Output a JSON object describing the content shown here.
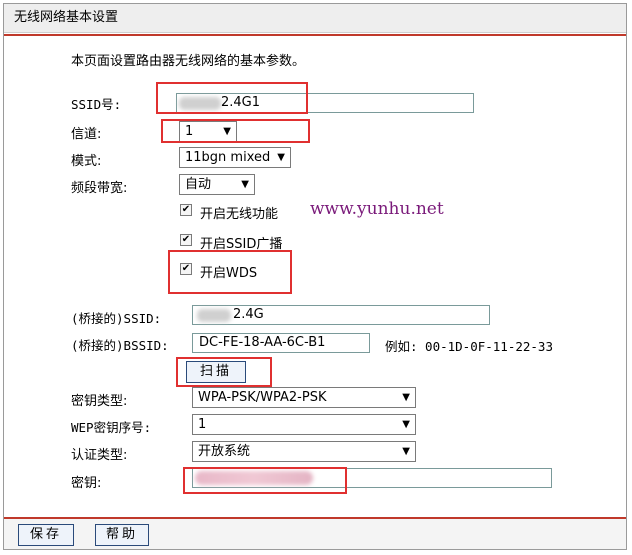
{
  "page": {
    "title": "无线网络基本设置",
    "description": "本页面设置路由器无线网络的基本参数。"
  },
  "form": {
    "ssid_label": "SSID号:",
    "ssid_value": "2.4G1",
    "channel_label": "信道:",
    "channel_value": "1",
    "mode_label": "模式:",
    "mode_value": "11bgn mixed",
    "bandwidth_label": "频段带宽:",
    "bandwidth_value": "自动",
    "enable_wireless_label": "开启无线功能",
    "enable_wireless_checked": true,
    "enable_ssid_broadcast_label": "开启SSID广播",
    "enable_ssid_broadcast_checked": true,
    "enable_wds_label": "开启WDS",
    "enable_wds_checked": true,
    "bridge_ssid_label": "(桥接的)SSID:",
    "bridge_ssid_value": "2.4G",
    "bridge_bssid_label": "(桥接的)BSSID:",
    "bridge_bssid_value": "DC-FE-18-AA-6C-B1",
    "bssid_example": "例如: 00-1D-0F-11-22-33",
    "scan_label": "扫描",
    "key_type_label": "密钥类型:",
    "key_type_value": "WPA-PSK/WPA2-PSK",
    "wep_index_label": "WEP密钥序号:",
    "wep_index_value": "1",
    "auth_type_label": "认证类型:",
    "auth_type_value": "开放系统",
    "key_label": "密钥:",
    "key_value": ""
  },
  "footer": {
    "save_label": "保存",
    "help_label": "帮助"
  },
  "watermark": "www.yunhu.net",
  "icons": {
    "dropdown": "chevron-down-icon",
    "checkbox": "checkmark-icon"
  },
  "colors": {
    "highlight": "#e03030",
    "title_bg": "#eeeeee",
    "watermark": "#7a1a7a"
  }
}
